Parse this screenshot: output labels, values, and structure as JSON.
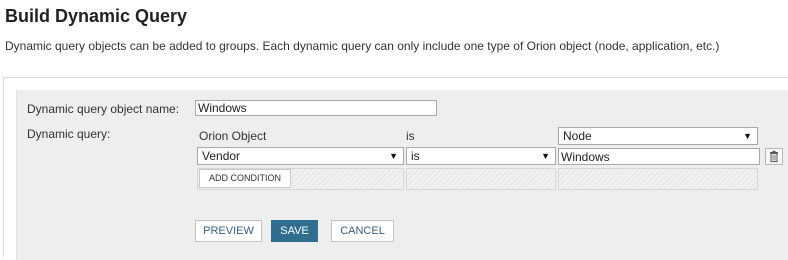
{
  "header": {
    "title": "Build Dynamic Query",
    "description": "Dynamic query objects can be added to groups. Each dynamic query can only include one type of Orion object (node, application, etc.)"
  },
  "form": {
    "object_name_label": "Dynamic query object name:",
    "object_name_value": "Windows",
    "dynamic_query_label": "Dynamic query:",
    "orion_object_label": "Orion Object",
    "is_label": "is",
    "object_type": "Node",
    "condition": {
      "field": "Vendor",
      "operator": "is",
      "value": "Windows"
    },
    "add_condition_label": "ADD CONDITION"
  },
  "buttons": {
    "preview": "PREVIEW",
    "save": "SAVE",
    "cancel": "CANCEL"
  },
  "icons": {
    "delete": "trash-icon",
    "dropdown": "caret-down-icon"
  },
  "colors": {
    "primary_button": "#2f6e8e",
    "panel_background": "#eeeeee"
  }
}
